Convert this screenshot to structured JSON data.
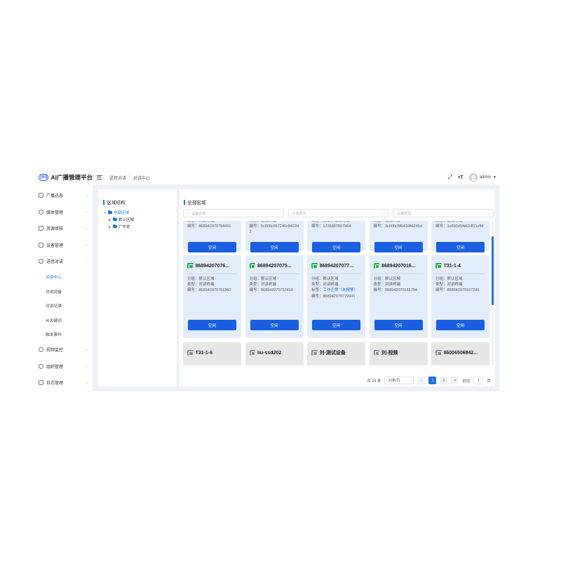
{
  "header": {
    "logo_badge": "(Ai)",
    "app_title": "AI广播管理平台",
    "breadcrumb": [
      "语音对讲",
      "/",
      "对讲中心"
    ],
    "fullscreen_icon": "fullscreen-icon",
    "font_size_icon": "font-size-icon",
    "user_name": "admin"
  },
  "sidebar": {
    "items": [
      {
        "label": "广播迅息",
        "icon": "broadcast-icon"
      },
      {
        "label": "媒体管理",
        "icon": "media-icon"
      },
      {
        "label": "资源审核",
        "icon": "audit-icon"
      },
      {
        "label": "设备管理",
        "icon": "device-icon"
      },
      {
        "label": "语音对讲",
        "icon": "mic-icon"
      },
      {
        "label": "视频监控",
        "icon": "camera-icon"
      },
      {
        "label": "组织管理",
        "icon": "org-icon"
      },
      {
        "label": "日志管理",
        "icon": "log-icon"
      }
    ],
    "sub_items": [
      "对讲中心",
      "对讲设备",
      "对讲记录",
      "AI关键词",
      "触发事件"
    ]
  },
  "tree": {
    "title": "区域结构",
    "root": "全部区域",
    "children": [
      "默认区域",
      "广东省"
    ]
  },
  "main": {
    "title": "全部区域",
    "filters": {
      "name_placeholder": "设备名称",
      "status_placeholder": "在线状态",
      "type_placeholder": "设备类型"
    },
    "call_label": "空闲",
    "field_labels": {
      "group": "分组：",
      "type": "类型：",
      "number": "编号：",
      "tag": "标签："
    },
    "row1_cards": [
      {
        "type": "类型：对讲终端",
        "number": "编号：868942070754431"
      },
      {
        "type": "类型：话筒终端",
        "number": "编号：5c000c657240c8422d2"
      },
      {
        "type": "类型：关键字触发终端",
        "number": "编号：1735887807964"
      },
      {
        "type": "类型：话筒终端",
        "number": "编号：3c000c5f643086245d"
      },
      {
        "type": "类型：话筒终端",
        "number": "编号：1c000c5f442c811c9d"
      }
    ],
    "row2_cards": [
      {
        "name": "86894207076...",
        "group": "分组：默认区域",
        "type": "类型：对讲终端",
        "number": "编号：868942070761360"
      },
      {
        "name": "86894207075...",
        "group": "分组：默认区域",
        "type": "类型：对讲终端",
        "number": "编号：868942070757418"
      },
      {
        "name": "86894207077...",
        "group": "分组：默认区域",
        "type": "类型：对讲终端",
        "tag_label": "标签：",
        "tag_value": "工作正常（未报警）",
        "number": "编号：868942070779941"
      },
      {
        "name": "86894207016...",
        "group": "分组：默认区域",
        "type": "类型：对讲终端",
        "number": "编号：868942070165794"
      },
      {
        "name": "T31-1-4",
        "group": "分组：默认区域",
        "type": "类型：对讲终端",
        "number": "编号：868942070167295"
      }
    ],
    "row3_cards": [
      {
        "name": "T31-1-6"
      },
      {
        "name": "liu-ssd202"
      },
      {
        "name": "刘-测试设备"
      },
      {
        "name": "刘-视频"
      },
      {
        "name": "86006506842..."
      }
    ]
  },
  "pagination": {
    "total": "共 24 条",
    "page_size": "20条/页",
    "prev": "<",
    "pages": [
      "1",
      "2"
    ],
    "next": ">",
    "goto_label": "前往",
    "goto_value": "1",
    "page_unit": "页"
  },
  "colors": {
    "accent": "#1f6fe8",
    "button": "#1a5fe0",
    "online": "#22b14c",
    "offline": "#8a8c90",
    "card_online": "#e3ecf9",
    "card_offline": "#e6e7e9"
  }
}
